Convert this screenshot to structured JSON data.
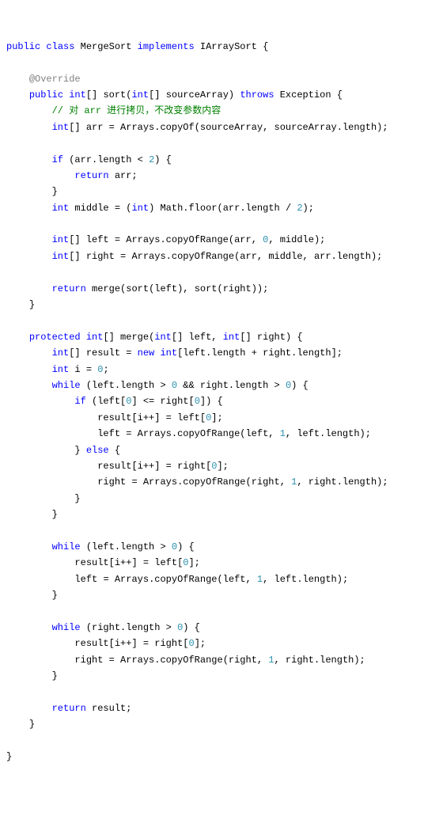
{
  "code": {
    "l1": {
      "kw1": "public",
      "kw2": "class",
      "name": "MergeSort",
      "kw3": "implements",
      "iface": "IArraySort",
      "brace": "{"
    },
    "l2": "",
    "l3": {
      "ann": "@Override"
    },
    "l4": {
      "kw1": "public",
      "type": "int",
      "arr": "[]",
      "fn": "sort",
      "lp": "(",
      "ptype": "int",
      "parr": "[]",
      "pname": "sourceArray",
      "rp": ")",
      "kw2": "throws",
      "exc": "Exception",
      "brace": "{"
    },
    "l5": {
      "cm": "// 对 arr 进行拷贝，不改变参数内容"
    },
    "l6": {
      "type": "int",
      "arr": "[]",
      "var": "arr",
      "eq": "=",
      "cls": "Arrays",
      "dot": ".",
      "fn": "copyOf",
      "lp": "(",
      "a1": "sourceArray",
      "comma": ",",
      "a2": "sourceArray",
      "dot2": ".",
      "prop": "length",
      "rp": ");"
    },
    "l7": "",
    "l8": {
      "kw": "if",
      "lp": "(",
      "a": "arr",
      "dot": ".",
      "prop": "length",
      "op": "<",
      "num": "2",
      "rp": ") {"
    },
    "l9": {
      "kw": "return",
      "var": "arr",
      ";": ";"
    },
    "l10": {
      "brace": "}"
    },
    "l11": {
      "type": "int",
      "var": "middle",
      "eq": "=",
      "lp": "(",
      "cast": "int",
      "rp": ")",
      "cls": "Math",
      "dot": ".",
      "fn": "floor",
      "lp2": "(",
      "a": "arr",
      "dot2": ".",
      "prop": "length",
      "op": "/",
      "num": "2",
      "rp2": ");"
    },
    "l12": "",
    "l13": {
      "type": "int",
      "arr": "[]",
      "var": "left",
      "eq": "=",
      "cls": "Arrays",
      "dot": ".",
      "fn": "copyOfRange",
      "lp": "(",
      "a1": "arr",
      "c1": ",",
      "a2": "0",
      "c2": ",",
      "a3": "middle",
      "rp": ");"
    },
    "l14": {
      "type": "int",
      "arr": "[]",
      "var": "right",
      "eq": "=",
      "cls": "Arrays",
      "dot": ".",
      "fn": "copyOfRange",
      "lp": "(",
      "a1": "arr",
      "c1": ",",
      "a2": "middle",
      "c2": ",",
      "a3": "arr",
      "dot2": ".",
      "prop": "length",
      "rp": ");"
    },
    "l15": "",
    "l16": {
      "kw": "return",
      "fn": "merge",
      "lp": "(",
      "f1": "sort",
      "lp1": "(",
      "a1": "left",
      "rp1": ")",
      "c": ",",
      "f2": "sort",
      "lp2": "(",
      "a2": "right",
      "rp2": ")",
      "rp": ");"
    },
    "l17": {
      "brace": "}"
    },
    "l18": "",
    "l19": {
      "kw1": "protected",
      "type": "int",
      "arr": "[]",
      "fn": "merge",
      "lp": "(",
      "pt1": "int",
      "pa1": "[]",
      "pn1": "left",
      "c": ",",
      "pt2": "int",
      "pa2": "[]",
      "pn2": "right",
      "rp": ") {"
    },
    "l20": {
      "type": "int",
      "arr": "[]",
      "var": "result",
      "eq": "=",
      "kw": "new",
      "type2": "int",
      "lb": "[",
      "a1": "left",
      "dot": ".",
      "prop": "length",
      "op": "+",
      "a2": "right",
      "dot2": ".",
      "prop2": "length",
      "rb": "];"
    },
    "l21": {
      "type": "int",
      "var": "i",
      "eq": "=",
      "num": "0",
      ";": ";"
    },
    "l22": {
      "kw": "while",
      "lp": "(",
      "a1": "left",
      "dot": ".",
      "prop": "length",
      "op": ">",
      "num": "0",
      "and": "&&",
      "a2": "right",
      "dot2": ".",
      "prop2": "length",
      "op2": ">",
      "num2": "0",
      "rp": ") {"
    },
    "l23": {
      "kw": "if",
      "lp": "(",
      "a1": "left",
      "lb": "[",
      "i1": "0",
      "rb": "]",
      "op": "<=",
      "a2": "right",
      "lb2": "[",
      "i2": "0",
      "rb2": "]",
      "rp": ") {"
    },
    "l24": {
      "a": "result",
      "lb": "[",
      "v": "i",
      "op": "++",
      "rb": "]",
      "eq": "=",
      "a2": "left",
      "lb2": "[",
      "i": "0",
      "rb2": "];"
    },
    "l25": {
      "var": "left",
      "eq": "=",
      "cls": "Arrays",
      "dot": ".",
      "fn": "copyOfRange",
      "lp": "(",
      "a1": "left",
      "c1": ",",
      "a2": "1",
      "c2": ",",
      "a3": "left",
      "dot2": ".",
      "prop": "length",
      "rp": ");"
    },
    "l26": {
      "rb": "}",
      "kw": "else",
      "lb": "{"
    },
    "l27": {
      "a": "result",
      "lb": "[",
      "v": "i",
      "op": "++",
      "rb": "]",
      "eq": "=",
      "a2": "right",
      "lb2": "[",
      "i": "0",
      "rb2": "];"
    },
    "l28": {
      "var": "right",
      "eq": "=",
      "cls": "Arrays",
      "dot": ".",
      "fn": "copyOfRange",
      "lp": "(",
      "a1": "right",
      "c1": ",",
      "a2": "1",
      "c2": ",",
      "a3": "right",
      "dot2": ".",
      "prop": "length",
      "rp": ");"
    },
    "l29": {
      "brace": "}"
    },
    "l30": {
      "brace": "}"
    },
    "l31": "",
    "l32": {
      "kw": "while",
      "lp": "(",
      "a": "left",
      "dot": ".",
      "prop": "length",
      "op": ">",
      "num": "0",
      "rp": ") {"
    },
    "l33": {
      "a": "result",
      "lb": "[",
      "v": "i",
      "op": "++",
      "rb": "]",
      "eq": "=",
      "a2": "left",
      "lb2": "[",
      "i": "0",
      "rb2": "];"
    },
    "l34": {
      "var": "left",
      "eq": "=",
      "cls": "Arrays",
      "dot": ".",
      "fn": "copyOfRange",
      "lp": "(",
      "a1": "left",
      "c1": ",",
      "a2": "1",
      "c2": ",",
      "a3": "left",
      "dot2": ".",
      "prop": "length",
      "rp": ");"
    },
    "l35": {
      "brace": "}"
    },
    "l36": "",
    "l37": {
      "kw": "while",
      "lp": "(",
      "a": "right",
      "dot": ".",
      "prop": "length",
      "op": ">",
      "num": "0",
      "rp": ") {"
    },
    "l38": {
      "a": "result",
      "lb": "[",
      "v": "i",
      "op": "++",
      "rb": "]",
      "eq": "=",
      "a2": "right",
      "lb2": "[",
      "i": "0",
      "rb2": "];"
    },
    "l39": {
      "var": "right",
      "eq": "=",
      "cls": "Arrays",
      "dot": ".",
      "fn": "copyOfRange",
      "lp": "(",
      "a1": "right",
      "c1": ",",
      "a2": "1",
      "c2": ",",
      "a3": "right",
      "dot2": ".",
      "prop": "length",
      "rp": ");"
    },
    "l40": {
      "brace": "}"
    },
    "l41": "",
    "l42": {
      "kw": "return",
      "var": "result",
      ";": ";"
    },
    "l43": {
      "brace": "}"
    },
    "l44": "",
    "l45": {
      "brace": "}"
    }
  }
}
